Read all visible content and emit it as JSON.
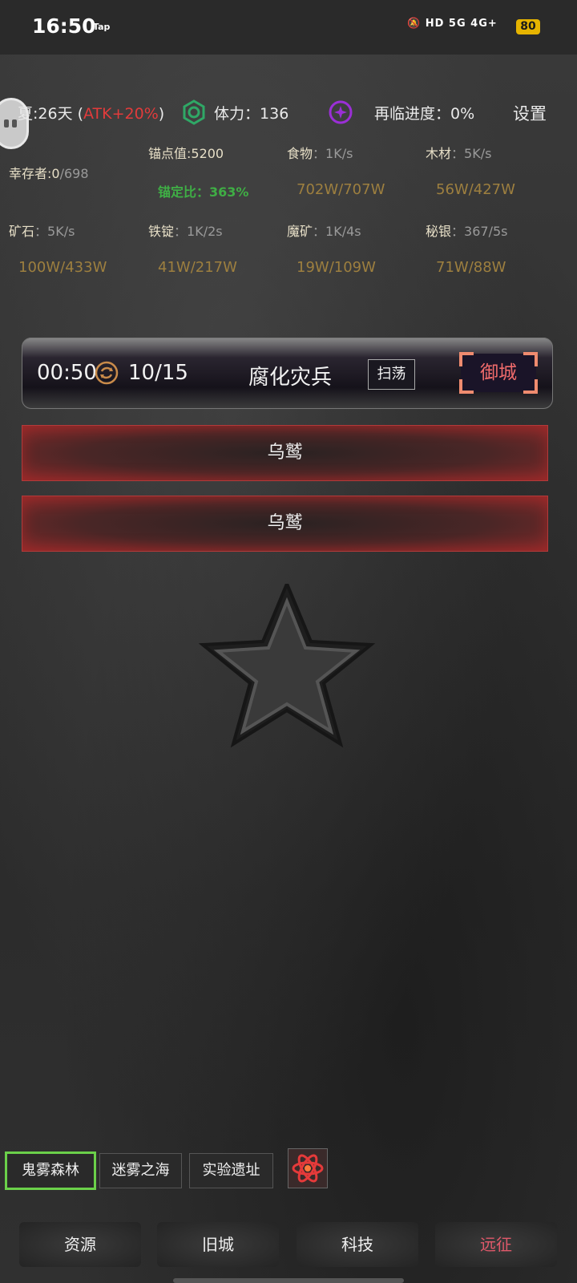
{
  "status_bar": {
    "time": "16:50",
    "tap_label": "Tap",
    "icons": "🔕 HD 5G 4G+",
    "battery": "80"
  },
  "header": {
    "season_prefix": "夏:26天 (",
    "season_bonus": "ATK+20%",
    "season_suffix": ")",
    "stamina_label": "体力：",
    "stamina_value": "136",
    "revisit_label": "再临进度：",
    "revisit_value": "0%",
    "settings": "设置"
  },
  "stats": {
    "anchor_value": "锚点值:5200",
    "survivors_label": "幸存者:0",
    "survivors_max": "/698",
    "anchor_ratio_label": "锚定比：",
    "anchor_ratio_value": "363%"
  },
  "resources": [
    {
      "name": "食物",
      "rate": "1K/s",
      "amount": "702W/707W"
    },
    {
      "name": "木材",
      "rate": "5K/s",
      "amount": "56W/427W"
    },
    {
      "name": "矿石",
      "rate": "5K/s",
      "amount": "100W/433W"
    },
    {
      "name": "铁锭",
      "rate": "1K/2s",
      "amount": "41W/217W"
    },
    {
      "name": "魔矿",
      "rate": "1K/4s",
      "amount": "19W/109W"
    },
    {
      "name": "秘银",
      "rate": "367/5s",
      "amount": "71W/88W"
    }
  ],
  "resource_separator": "：",
  "battle": {
    "timer": "00:50",
    "count": "10/15",
    "enemy": "腐化灾兵",
    "sweep": "扫荡",
    "defend": "御城"
  },
  "enemies": [
    "乌鹫",
    "乌鹫"
  ],
  "map_tabs": [
    "鬼雾森林",
    "迷雾之海",
    "实验遗址"
  ],
  "nav": [
    "资源",
    "旧城",
    "科技",
    "远征"
  ],
  "colors": {
    "accent_red": "#e23b3b",
    "accent_green": "#3fae45",
    "amount_gold": "#9d7f3f",
    "selected_tab_border": "#6bd04a"
  }
}
